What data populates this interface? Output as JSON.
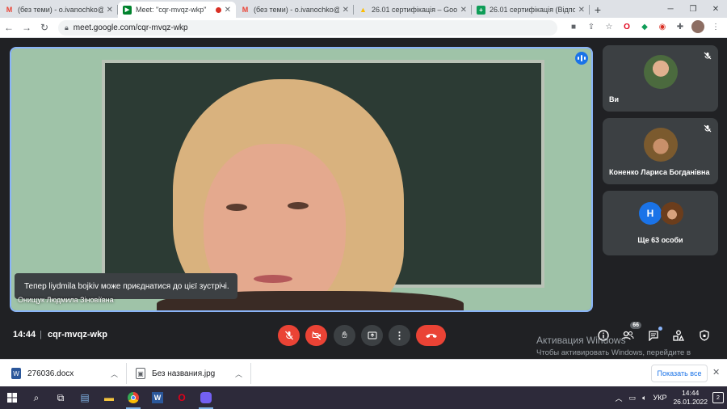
{
  "browser": {
    "tabs": [
      {
        "title": "(без теми) - o.ivanochko@ip",
        "icon": "gmail-icon",
        "active": false
      },
      {
        "title": "Meet: \"cqr-mvqz-wkp\"",
        "icon": "meet-icon",
        "active": true,
        "recording": true
      },
      {
        "title": "(без теми) - o.ivanochko@ip",
        "icon": "gmail-icon",
        "active": false
      },
      {
        "title": "26.01 сертифікація – Google",
        "icon": "drive-icon",
        "active": false
      },
      {
        "title": "26.01 сертифікація (Відпові",
        "icon": "sheets-icon",
        "active": false
      }
    ],
    "new_tab": "+",
    "url": "meet.google.com/cqr-mvqz-wkp"
  },
  "meeting": {
    "presenter_name": "Онищук Людмила Зіновіївна",
    "join_toast": "Тепер liydmila bojkiv може приєднатися до цієї зустрічі.",
    "time": "14:44",
    "separator": "|",
    "code": "cqr-mvqz-wkp",
    "participants_count": "66",
    "tiles": [
      {
        "name": "Ви",
        "muted": true
      },
      {
        "name": "Коненко Лариса Богданівна",
        "muted": true
      },
      {
        "name": "Ще 63 особи",
        "avatar_letter": "Н"
      }
    ],
    "colors": {
      "end_call": "#ea4335",
      "active_border": "#8ab4f8",
      "background": "#202124"
    }
  },
  "watermark": {
    "title": "Активация Windows",
    "body": "Чтобы активировать Windows, перейдите в раздел \"Параметры\"."
  },
  "downloads": {
    "items": [
      {
        "name": "276036.docx",
        "icon": "word-doc-icon"
      },
      {
        "name": "Без названия.jpg",
        "icon": "image-file-icon"
      }
    ],
    "show_all": "Показать все"
  },
  "taskbar": {
    "language": "УКР",
    "time": "14:44",
    "date": "26.01.2022",
    "notifications": "2"
  }
}
